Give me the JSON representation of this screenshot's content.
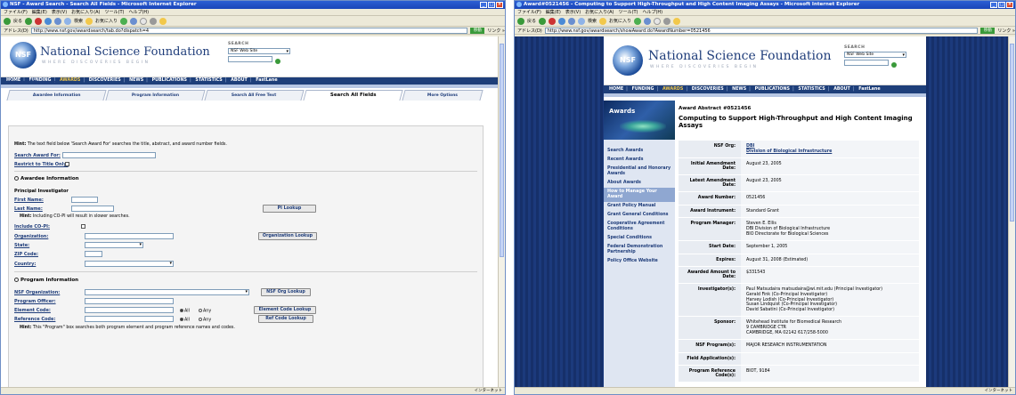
{
  "left": {
    "window_title": "NSF - Award Search - Search All Fields - Microsoft Internet Explorer",
    "menu": [
      "ファイル(F)",
      "編集(E)",
      "表示(V)",
      "お気に入り(A)",
      "ツール(T)",
      "ヘルプ(H)"
    ],
    "toolbar": {
      "back": "戻る",
      "search": "検索",
      "favorites": "お気に入り"
    },
    "address_label": "アドレス(D)",
    "address": "http://www.nsf.gov/awardsearch/tab.do?dispatch=4",
    "go": "移動",
    "links": "リンク »",
    "header": {
      "org": "National Science Foundation",
      "tagline": "WHERE DISCOVERIES BEGIN",
      "search_label": "SEARCH",
      "search_scope": "NSF Web Site"
    },
    "nav": [
      "HOME",
      "FUNDING",
      "AWARDS",
      "DISCOVERIES",
      "NEWS",
      "PUBLICATIONS",
      "STATISTICS",
      "ABOUT",
      "FastLane"
    ],
    "page_title": "Award Search",
    "top_links": "Send Comments | Award Search Help",
    "tabs": [
      "Awardee Information",
      "Program Information",
      "Search All Free Text",
      "Search All Fields",
      "More Options"
    ],
    "form": {
      "hint1": "The text field below 'Search Award For' searches the title, abstract, and award number fields.",
      "hint_label": "Hint:",
      "search_award_for": "Search Award For:",
      "restrict_title": "Restrict to Title Only:",
      "awardee_section": "Awardee Information",
      "pi_section": "Principal Investigator",
      "first_name": "First Name:",
      "last_name": "Last Name:",
      "pi_lookup": "PI Lookup",
      "hint2": "Including CO-PI will result in slower searches.",
      "include_copi": "Include CO-PI:",
      "organization": "Organization:",
      "org_lookup": "Organization Lookup",
      "state": "State:",
      "zip": "ZIP Code:",
      "country": "Country:",
      "program_section": "Program Information",
      "nsf_org": "NSF Organization:",
      "nsf_org_lookup": "NSF Org Lookup",
      "program_officer": "Program Officer:",
      "element_code": "Element Code:",
      "element_lookup": "Element Code Lookup",
      "reference_code": "Reference Code:",
      "ref_lookup": "Ref Code Lookup",
      "all": "All",
      "any": "Any",
      "hint3": "This \"Program\" box searches both program element and program reference names and codes."
    },
    "status": "インターネット"
  },
  "right": {
    "window_title": "Award#0521456 - Computing to Support High-Throughput and High Content Imaging Assays - Microsoft Internet Explorer",
    "menu": [
      "ファイル(F)",
      "編集(E)",
      "表示(V)",
      "お気に入り(A)",
      "ツール(T)",
      "ヘルプ(H)"
    ],
    "address_label": "アドレス(D)",
    "address": "http://www.nsf.gov/awardsearch/showAward.do?AwardNumber=0521456",
    "go": "移動",
    "links": "リンク »",
    "header": {
      "org": "National Science Foundation",
      "tagline": "WHERE DISCOVERIES BEGIN",
      "search_label": "SEARCH",
      "search_scope": "NSF Web Site"
    },
    "nav": [
      "HOME",
      "FUNDING",
      "AWARDS",
      "DISCOVERIES",
      "NEWS",
      "PUBLICATIONS",
      "STATISTICS",
      "ABOUT",
      "FastLane"
    ],
    "left_banner": "Awards",
    "left_nav": [
      "Search Awards",
      "Recent Awards",
      "Presidential and Honorary Awards",
      "About Awards",
      "How to Manage Your Award",
      "Grant Policy Manual",
      "Grant General Conditions",
      "Cooperative Agreement Conditions",
      "Special Conditions",
      "Federal Demonstration Partnership",
      "Policy Office Website"
    ],
    "abstract_title": "Award Abstract #0521456",
    "abstract_heading": "Computing to Support High-Throughput and High Content Imaging Assays",
    "rows": [
      {
        "k": "NSF Org:",
        "v": "DBI\nDivision of Biological Infrastructure",
        "link": true
      },
      {
        "k": "Initial Amendment Date:",
        "v": "August 23, 2005"
      },
      {
        "k": "Latest Amendment Date:",
        "v": "August 23, 2005"
      },
      {
        "k": "Award Number:",
        "v": "0521456"
      },
      {
        "k": "Award Instrument:",
        "v": "Standard Grant"
      },
      {
        "k": "Program Manager:",
        "v": "Steven E. Ellis\nDBI Division of Biological Infrastructure\nBIO Directorate for Biological Sciences"
      },
      {
        "k": "Start Date:",
        "v": "September 1, 2005"
      },
      {
        "k": "Expires:",
        "v": "August 31, 2008 (Estimated)"
      },
      {
        "k": "Awarded Amount to Date:",
        "v": "$331543"
      },
      {
        "k": "Investigator(s):",
        "v": "Paul Matsudaira matsudaira@wi.mit.edu (Principal Investigator)\nGerald Fink (Co-Principal Investigator)\nHarvey Lodish (Co-Principal Investigator)\nSusan Lindquist (Co-Principal Investigator)\nDavid Sabatini (Co-Principal Investigator)"
      },
      {
        "k": "Sponsor:",
        "v": "Whitehead Institute for Biomedical Research\n9 CAMBRIDGE CTR\nCAMBRIDGE, MA 02142 617/258-5000"
      },
      {
        "k": "NSF Program(s):",
        "v": "MAJOR RESEARCH INSTRUMENTATION"
      },
      {
        "k": "Field Application(s):",
        "v": ""
      },
      {
        "k": "Program Reference Code(s):",
        "v": "BIOT, 9184"
      }
    ],
    "status": "インターネット"
  }
}
